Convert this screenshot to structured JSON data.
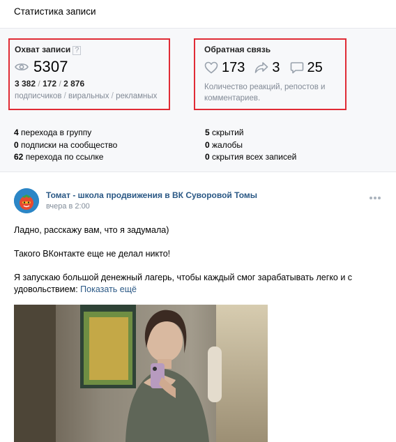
{
  "header": {
    "title": "Статистика записи"
  },
  "reach": {
    "title": "Охват записи",
    "help": "?",
    "total": "5307",
    "subscribers": "3 382",
    "viral": "172",
    "ads": "2 876",
    "separator": "/",
    "legend_subscribers": "подписчиков",
    "legend_viral": "виральных",
    "legend_ads": "рекламных"
  },
  "feedback": {
    "title": "Обратная связь",
    "likes": "173",
    "reposts": "3",
    "comments": "25",
    "description": "Количество реакций, репостов и комментариев."
  },
  "counters_left": [
    {
      "num": "4",
      "text": "перехода в группу"
    },
    {
      "num": "0",
      "text": "подписки на сообщество"
    },
    {
      "num": "62",
      "text": "перехода по ссылке"
    }
  ],
  "counters_right": [
    {
      "num": "5",
      "text": "скрытий"
    },
    {
      "num": "0",
      "text": "жалобы"
    },
    {
      "num": "0",
      "text": "скрытия всех записей"
    }
  ],
  "post": {
    "author": "Томат - школа продвижения в ВК Суворовой Томы",
    "time": "вчера в 2:00",
    "paragraph1": "Ладно, расскажу вам, что я задумала)",
    "paragraph2": "Такого ВКонтакте еще не делал никто!",
    "paragraph3": "Я запускаю большой денежный лагерь, чтобы каждый смог зарабатывать легко и с удовольствием:",
    "show_more": "Показать ещё"
  },
  "colors": {
    "highlight_border": "#e02b35",
    "link": "#2a5885",
    "muted": "#828a96"
  }
}
